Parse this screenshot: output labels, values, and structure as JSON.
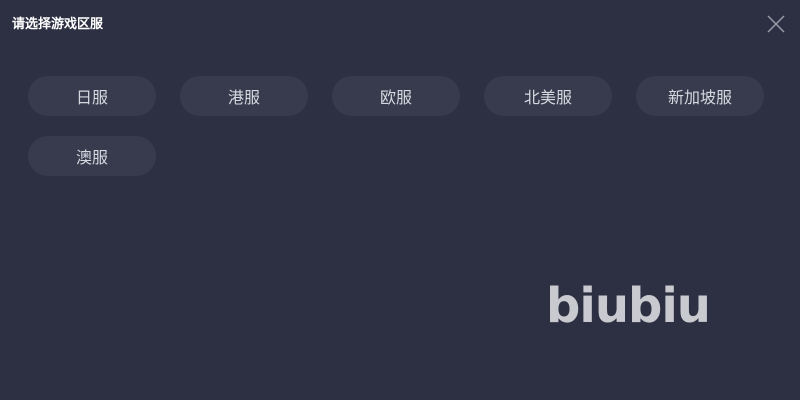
{
  "dialog": {
    "title": "请选择游戏区服"
  },
  "servers": [
    {
      "label": "日服"
    },
    {
      "label": "港服"
    },
    {
      "label": "欧服"
    },
    {
      "label": "北美服"
    },
    {
      "label": "新加坡服"
    },
    {
      "label": "澳服"
    }
  ],
  "brand": {
    "logo_text": "biubiu",
    "logo_color": "#c9cad0"
  },
  "icons": {
    "close": "close-icon"
  }
}
